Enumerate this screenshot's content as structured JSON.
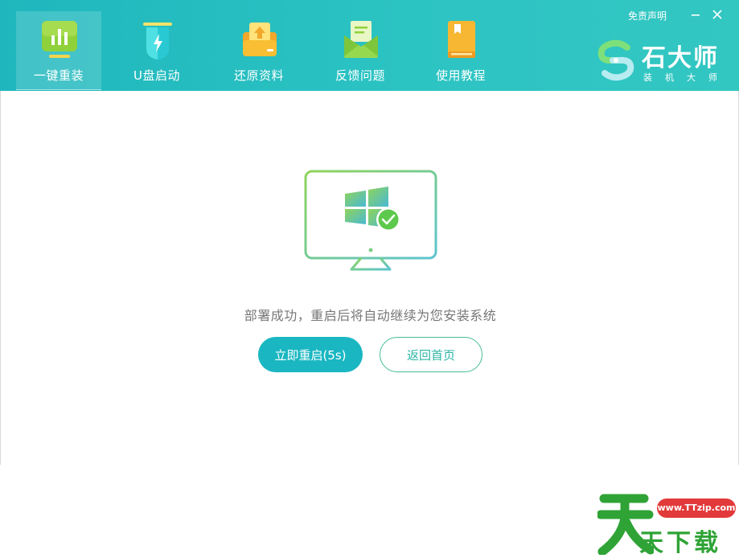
{
  "header": {
    "tabs": [
      {
        "label": "一键重装",
        "icon": "bar-chart-icon",
        "active": true
      },
      {
        "label": "U盘启动",
        "icon": "usb-drive-icon",
        "active": false
      },
      {
        "label": "还原资料",
        "icon": "restore-upload-icon",
        "active": false
      },
      {
        "label": "反馈问题",
        "icon": "feedback-mail-icon",
        "active": false
      },
      {
        "label": "使用教程",
        "icon": "tutorial-book-icon",
        "active": false
      }
    ],
    "disclaimer": "免责声明",
    "brand_name": "石大师",
    "brand_sub": "装机大师"
  },
  "main": {
    "message": "部署成功，重启后将自动继续为您安装系统",
    "restart_label": "立即重启(5s)",
    "home_label": "返回首页"
  },
  "watermark": {
    "url": "www.TTzip.com",
    "text": "天下载"
  },
  "colors": {
    "header_bg": "#2cc3c3",
    "primary_button": "#1ab7c2",
    "outline_button": "#45bd8f",
    "message_text": "#777777"
  }
}
